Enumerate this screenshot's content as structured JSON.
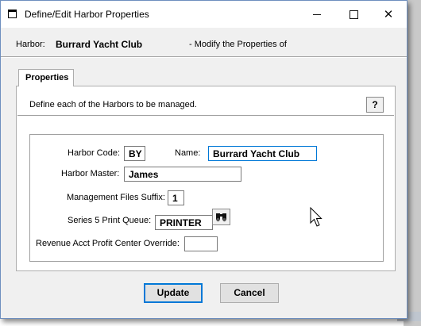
{
  "window": {
    "title": "Define/Edit Harbor Properties",
    "controls": {
      "minimize": "minimize",
      "maximize": "maximize",
      "close": "✕"
    }
  },
  "header": {
    "label": "Harbor:",
    "value": "Burrard Yacht Club",
    "suffix": "- Modify the Properties of"
  },
  "tabs": [
    {
      "label": "Properties"
    }
  ],
  "panel": {
    "description": "Define each of the Harbors to be managed.",
    "help_icon": "help-question-icon",
    "help_glyph": "?"
  },
  "form": {
    "harbor_code": {
      "label": "Harbor Code:",
      "value": "BY"
    },
    "name": {
      "label": "Name:",
      "value": "Burrard Yacht Club"
    },
    "harbor_master": {
      "label": "Harbor Master:",
      "value": "James"
    },
    "mgmt_suffix": {
      "label": "Management Files Suffix:",
      "value": "1"
    },
    "print_queue": {
      "label": "Series 5 Print Queue:",
      "value": "PRINTER",
      "lookup_icon": "binoculars-icon"
    },
    "revenue_override": {
      "label": "Revenue Acct Profit Center Override:",
      "value": ""
    }
  },
  "buttons": {
    "update": "Update",
    "cancel": "Cancel"
  },
  "colors": {
    "focus": "#0078d7",
    "window_border": "#6e8fbf",
    "face": "#f0f0f0"
  }
}
